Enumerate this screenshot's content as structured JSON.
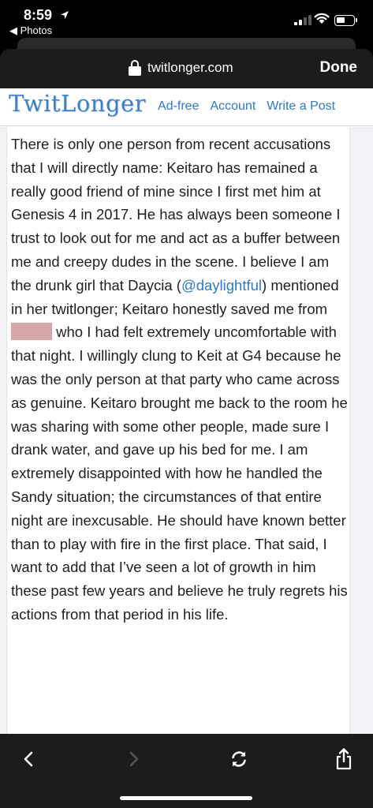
{
  "status_bar": {
    "time": "8:59",
    "back_app": "◀ Photos"
  },
  "browser": {
    "url": "twitlonger.com",
    "done_label": "Done"
  },
  "site": {
    "logo": "TwitLonger",
    "nav": [
      "Ad-free",
      "Account",
      "Write a Post"
    ]
  },
  "article": {
    "part1": "There is only one person from recent accusations that I will directly name: Keitaro has remained a really good friend of mine since I first met him at Genesis 4 in 2017. He has always been someone I trust to look out for me and act as a buffer between me and creepy dudes in the scene. I believe I am the drunk girl that Daycia (",
    "mention": "@daylightful",
    "part2": ") mentioned in her twitlonger; Keitaro honestly saved me from ",
    "part3": " who I had felt extremely uncomfortable with that night. I willingly clung to Keit at G4 because he was the only person at that party who came across as genuine. Keitaro brought me back to the room he was sharing with some other people, made sure I drank water, and gave up his bed for me. I am extremely disappointed with how he handled the Sandy situation; the circumstances of that entire night are inexcusable. He should have known better than to play with fire in the first place. That said, I want to add that I’ve seen a lot of growth in him these past few years and believe he truly regrets his actions from that period in his life."
  },
  "toolbar": {
    "icons": [
      "chevron-left-icon",
      "chevron-right-icon",
      "refresh-icon",
      "share-icon"
    ]
  },
  "colors": {
    "link": "#2d79c7",
    "redaction": "#d6a7a7",
    "chrome": "#1c1c1e"
  }
}
